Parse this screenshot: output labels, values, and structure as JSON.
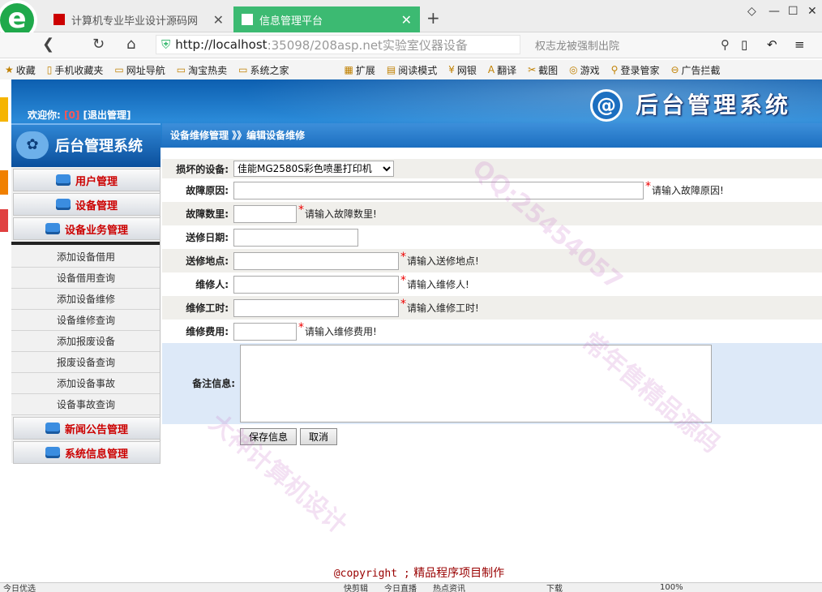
{
  "browser": {
    "tab1_title": "计算机专业毕业设计源码网",
    "tab2_title": "信息管理平台",
    "url_host": "http://localhost",
    "url_rest": ":35098/208asp.net实验室仪器设备",
    "search_hint": "权志龙被强制出院",
    "bookmarks": [
      "收藏",
      "手机收藏夹",
      "网址导航",
      "淘宝热卖",
      "系统之家"
    ],
    "tools": [
      "扩展",
      "阅读模式",
      "网银",
      "翻译",
      "截图",
      "游戏",
      "登录管家",
      "广告拦截"
    ]
  },
  "header": {
    "welcome_label": "欢迎你:",
    "user": "[0]",
    "logout": "[退出管理]",
    "title": "后台管理系统"
  },
  "sidebar": {
    "title": "后台管理系统",
    "menu": [
      "用户管理",
      "设备管理",
      "设备业务管理"
    ],
    "items": [
      "添加设备借用",
      "设备借用查询",
      "添加设备维修",
      "设备维修查询",
      "添加报废设备",
      "报废设备查询",
      "添加设备事故",
      "设备事故查询"
    ],
    "menu2": [
      "新闻公告管理",
      "系统信息管理"
    ]
  },
  "breadcrumb": "设备维修管理 》》编辑设备维修",
  "form": {
    "device_label": "损坏的设备:",
    "device_value": "佳能MG2580S彩色喷墨打印机",
    "reason_label": "故障原因:",
    "reason_hint": "请输入故障原因!",
    "count_label": "故障数里:",
    "count_hint": "请输入故障数里!",
    "date_label": "送修日期:",
    "place_label": "送修地点:",
    "place_hint": "请输入送修地点!",
    "person_label": "维修人:",
    "person_hint": "请输入维修人!",
    "hours_label": "维修工时:",
    "hours_hint": "请输入维修工时!",
    "cost_label": "维修费用:",
    "cost_hint": "请输入维修费用!",
    "remark_label": "备注信息:",
    "save": "保存信息",
    "cancel": "取消"
  },
  "footer": {
    "copyright": "@copyright ;",
    "text": "精品程序项目制作"
  },
  "status": {
    "left": "今日优选",
    "items": [
      "快剪辑",
      "今日直播",
      "热点资讯",
      "下载",
      "100%"
    ]
  },
  "watermarks": [
    "QQ:25454057",
    "大神计算机设计",
    "常年售精品源码"
  ]
}
